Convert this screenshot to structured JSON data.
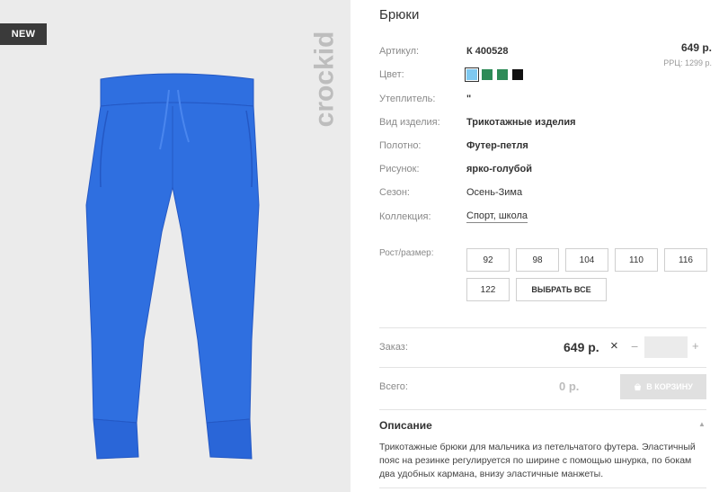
{
  "gallery": {
    "badge": "NEW",
    "brand": "crockid"
  },
  "product": {
    "title": "Брюки",
    "price": "649 р.",
    "rrp_label": "РРЦ:",
    "rrp_value": "1299 р.",
    "attributes": [
      {
        "label": "Артикул:",
        "value": "К 400528"
      },
      {
        "label": "Цвет:",
        "value": ""
      },
      {
        "label": "Утеплитель:",
        "value": "\""
      },
      {
        "label": "Вид изделия:",
        "value": "Трикотажные изделия"
      },
      {
        "label": "Полотно:",
        "value": "Футер-петля"
      },
      {
        "label": "Рисунок:",
        "value": "ярко-голубой"
      },
      {
        "label": "Сезон:",
        "value": "Осень-Зима"
      },
      {
        "label": "Коллекция:",
        "value": "Спорт, школа"
      }
    ],
    "colors": [
      "#7ec8f0",
      "#2e8b57",
      "#2e8b57",
      "#111111"
    ]
  },
  "sizes": {
    "label": "Рост/размер:",
    "options": [
      "92",
      "98",
      "104",
      "110",
      "116",
      "122"
    ],
    "select_all": "ВЫБРАТЬ ВСЕ"
  },
  "order": {
    "label": "Заказ:",
    "price": "649 р.",
    "remove": "×",
    "minus": "−",
    "plus": "+"
  },
  "total": {
    "label": "Всего:",
    "value": "0 р.",
    "cart_button": "В КОРЗИНУ"
  },
  "description": {
    "title": "Описание",
    "text": "Трикотажные брюки для мальчика из петельчатого футера. Эластичный пояс на резинке регулируется по ширине с помощью шнурка, по бокам два удобных кармана, внизу эластичные манжеты."
  },
  "colors": {
    "pants": "#2f6fe0",
    "pants_dark": "#2458c4",
    "gallery_bg": "#ebebeb"
  }
}
